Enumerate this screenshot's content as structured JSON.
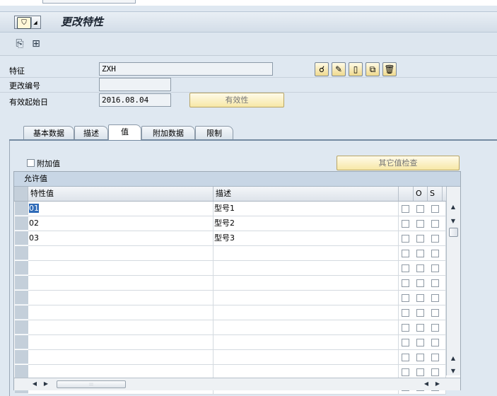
{
  "window": {
    "title": "更改特性"
  },
  "fields": [
    {
      "label": "特征",
      "value": "ZXH"
    },
    {
      "label": "更改编号",
      "value": ""
    },
    {
      "label": "有效起始日",
      "value": "2016.08.04"
    }
  ],
  "buttons": {
    "validity": "有效性",
    "other_value_check": "其它值检查"
  },
  "tabs": [
    "基本数据",
    "描述",
    "值",
    "附加数据",
    "限制"
  ],
  "active_tab": "值",
  "additional_values": {
    "label": "附加值",
    "checked": false
  },
  "table": {
    "title": "允许值",
    "columns": {
      "value": "特性值",
      "description": "描述",
      "o": "O",
      "s": "S"
    },
    "rows": [
      {
        "value": "01",
        "description": "型号1"
      },
      {
        "value": "02",
        "description": "型号2"
      },
      {
        "value": "03",
        "description": "型号3"
      }
    ]
  },
  "icons": {
    "menu": "menu-icon",
    "toolbar": [
      "display-change-icon",
      "other-object-icon"
    ],
    "header_buttons": [
      "glasses-icon",
      "pencil-icon",
      "new-document-icon",
      "copy-icon",
      "trash-icon"
    ],
    "table": [
      "column-settings-icon",
      "scroll-up-icon",
      "scroll-down-icon",
      "scroll-left-icon",
      "scroll-right-icon"
    ]
  }
}
